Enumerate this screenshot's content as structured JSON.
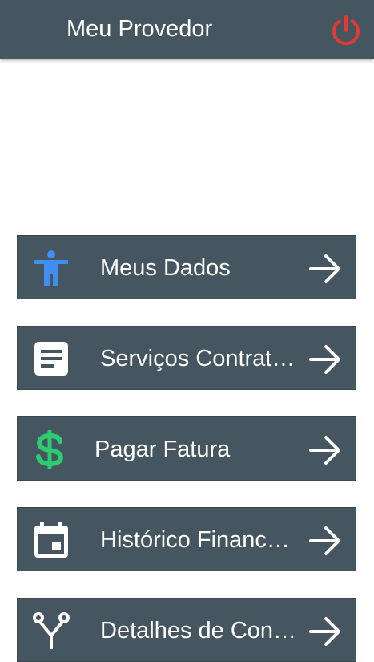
{
  "appbar": {
    "title": "Meu Provedor",
    "power_icon": "power-icon",
    "power_color": "#e53935",
    "background": "#455660"
  },
  "menu": {
    "items": [
      {
        "label": "Meus Dados",
        "icon": "accessibility-person-icon",
        "icon_color": "#3f8ef0"
      },
      {
        "label": "Serviços Contratados",
        "icon": "document-text-icon",
        "icon_color": "#ffffff"
      },
      {
        "label": "Pagar Fatura",
        "icon": "dollar-sign-icon",
        "icon_color": "#2ecc71"
      },
      {
        "label": "Histórico Financeiro",
        "icon": "calendar-icon",
        "icon_color": "#ffffff"
      },
      {
        "label": "Detalhes de Conexão",
        "icon": "connection-fork-icon",
        "icon_color": "#ffffff"
      }
    ],
    "arrow_icon": "arrow-right-icon"
  }
}
